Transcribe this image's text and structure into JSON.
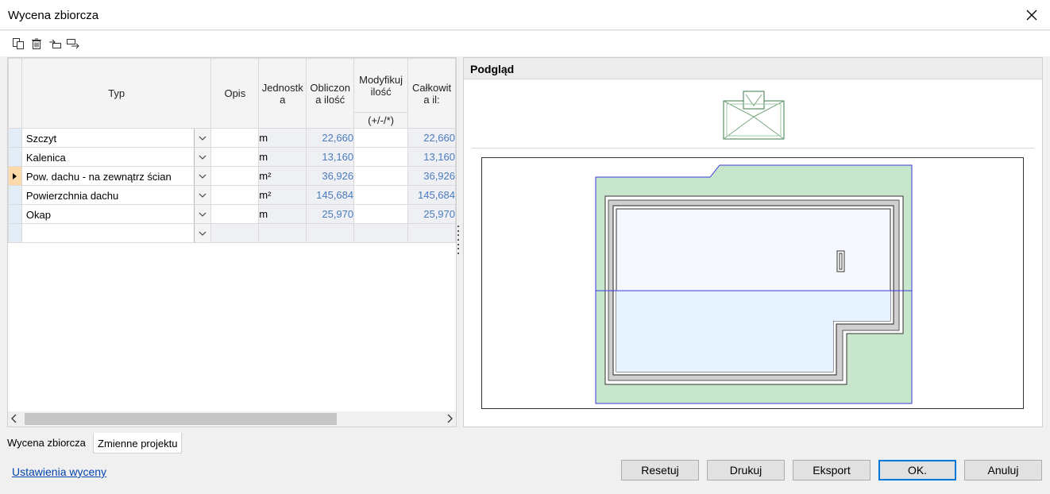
{
  "window": {
    "title": "Wycena zbiorcza"
  },
  "toolbar": {
    "icons": [
      "copy-icon",
      "delete-icon",
      "move-up-icon",
      "move-down-icon"
    ]
  },
  "grid": {
    "columns": {
      "typ": "Typ",
      "opis": "Opis",
      "jednostka": "Jednostk a",
      "obliczona": "Obliczon a ilość",
      "modyfikuj": "Modyfikuj ilość",
      "modyfikuj_sub": "(+/-/*)",
      "calkowita": "Całkowit a il:"
    },
    "rows": [
      {
        "typ": "Szczyt",
        "opis": "",
        "unit": "m",
        "calc": "22,660",
        "mod": "",
        "total": "22,660"
      },
      {
        "typ": "Kalenica",
        "opis": "",
        "unit": "m",
        "calc": "13,160",
        "mod": "",
        "total": "13,160"
      },
      {
        "typ": "Pow. dachu - na zewnątrz ścian",
        "opis": "",
        "unit": "m²",
        "calc": "36,926",
        "mod": "",
        "total": "36,926"
      },
      {
        "typ": "Powierzchnia dachu",
        "opis": "",
        "unit": "m²",
        "calc": "145,684",
        "mod": "",
        "total": "145,684"
      },
      {
        "typ": "Okap",
        "opis": "",
        "unit": "m",
        "calc": "25,970",
        "mod": "",
        "total": "25,970"
      },
      {
        "typ": "",
        "opis": "",
        "unit": "",
        "calc": "",
        "mod": "",
        "total": ""
      }
    ],
    "current_row": 2
  },
  "preview": {
    "title": "Podgląd",
    "colors": {
      "roof_green": "#c8e6cc",
      "outline_blue": "#3a3adf",
      "floor_blue": "#e6f2ff"
    }
  },
  "tabs": [
    {
      "label": "Wycena zbiorcza",
      "active": true
    },
    {
      "label": "Zmienne projektu",
      "active": false
    }
  ],
  "footer": {
    "settings_link": "Ustawienia wyceny",
    "buttons": {
      "reset": "Resetuj",
      "print": "Drukuj",
      "export": "Eksport",
      "ok": "OK.",
      "cancel": "Anuluj"
    }
  }
}
